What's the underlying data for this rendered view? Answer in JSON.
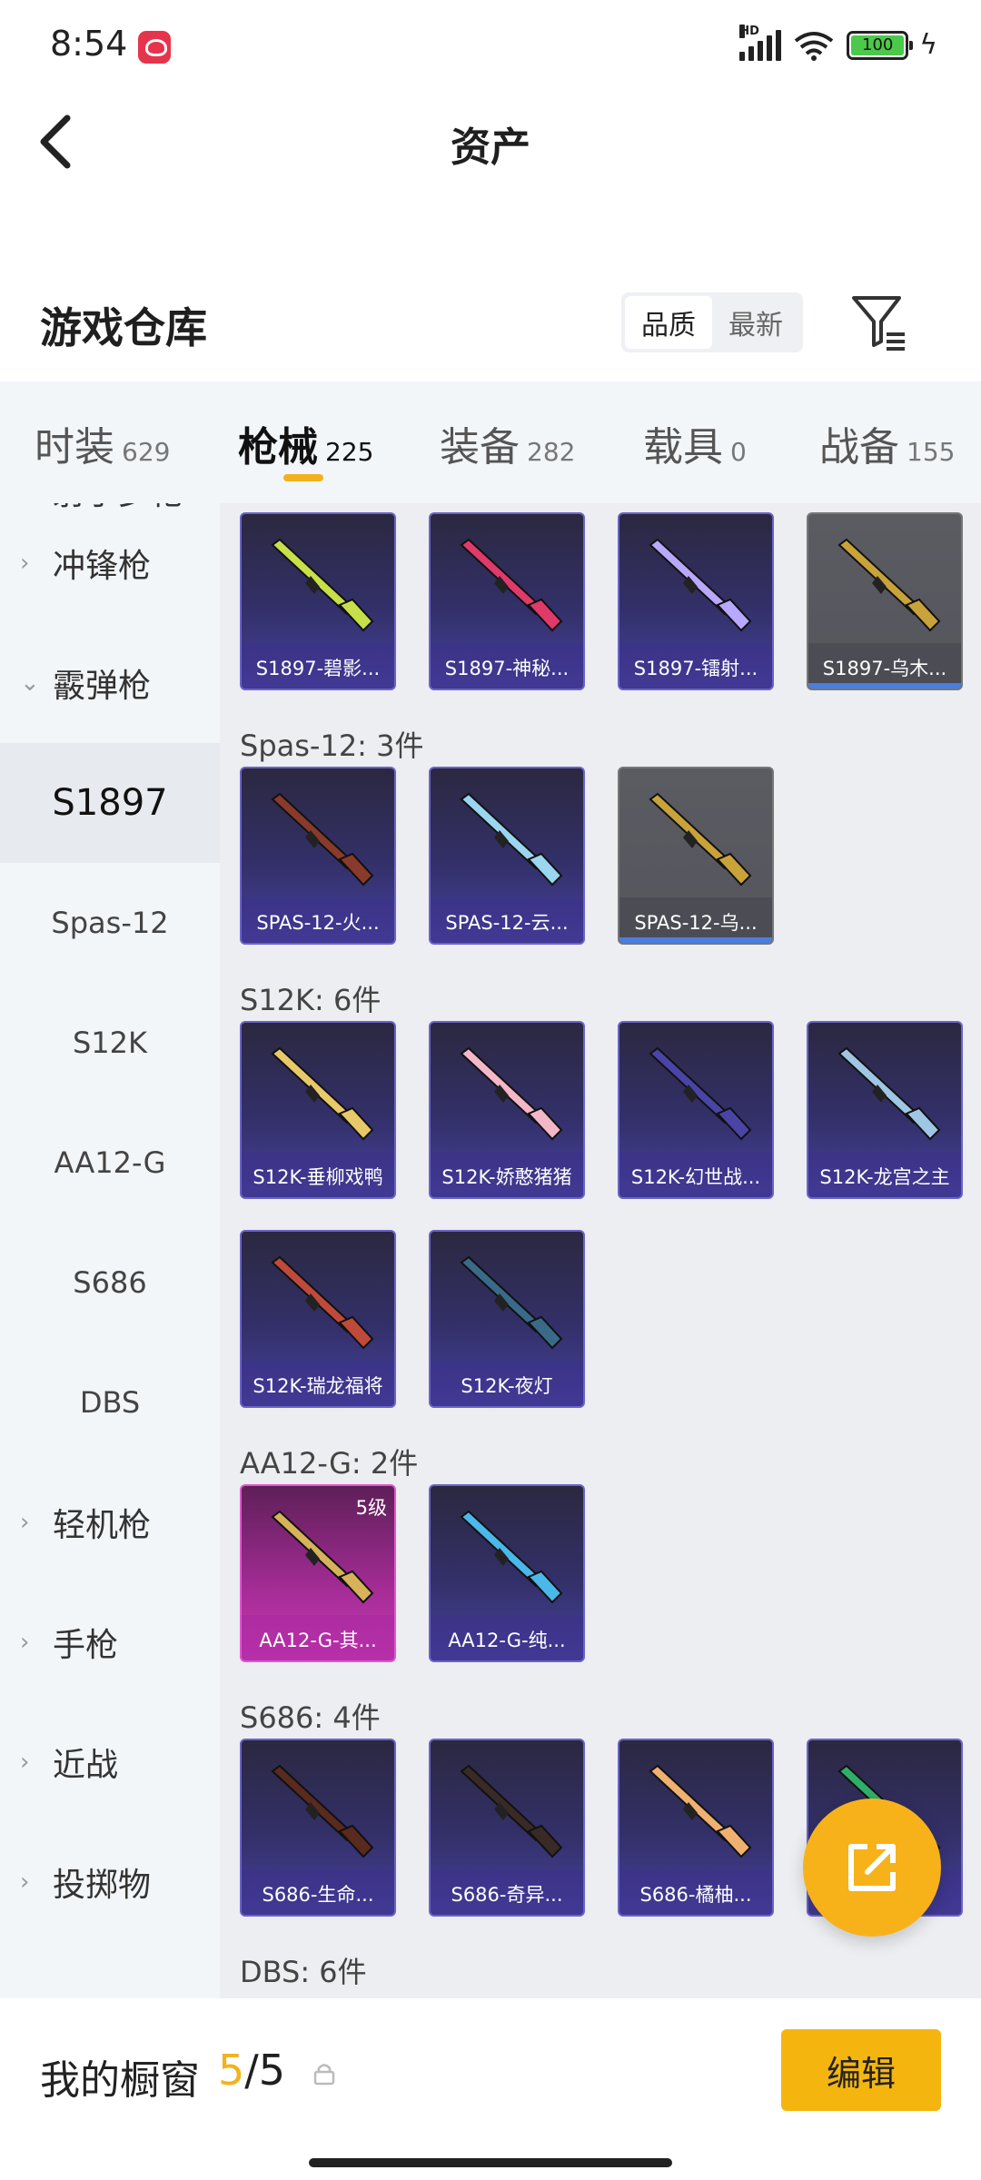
{
  "status_bar": {
    "time": "8:54",
    "battery": "100",
    "signal": "HD"
  },
  "header": {
    "title": "资产"
  },
  "warehouse": {
    "title": "游戏仓库",
    "sort_options": [
      "品质",
      "最新"
    ],
    "sort_selected": "品质"
  },
  "tabs": [
    {
      "label": "时装",
      "count": "629"
    },
    {
      "label": "枪械",
      "count": "225"
    },
    {
      "label": "装备",
      "count": "282"
    },
    {
      "label": "载具",
      "count": "0"
    },
    {
      "label": "战备",
      "count": "155"
    }
  ],
  "sidebar": {
    "partial_top": "射手步枪",
    "items": [
      {
        "type": "category",
        "label": "冲锋枪",
        "expanded": false
      },
      {
        "type": "category",
        "label": "霰弹枪",
        "expanded": true
      },
      {
        "type": "sub",
        "label": "S1897",
        "selected": true
      },
      {
        "type": "sub",
        "label": "Spas-12"
      },
      {
        "type": "sub",
        "label": "S12K"
      },
      {
        "type": "sub",
        "label": "AA12-G"
      },
      {
        "type": "sub",
        "label": "S686"
      },
      {
        "type": "sub",
        "label": "DBS"
      },
      {
        "type": "category",
        "label": "轻机枪",
        "expanded": false
      },
      {
        "type": "category",
        "label": "手枪",
        "expanded": false
      },
      {
        "type": "category",
        "label": "近战",
        "expanded": false
      },
      {
        "type": "category",
        "label": "投掷物",
        "expanded": false
      }
    ]
  },
  "sections": [
    {
      "label": "",
      "items": [
        {
          "name": "S1897-碧影...",
          "style": "purple",
          "gun_color": "#c7e04a"
        },
        {
          "name": "S1897-神秘...",
          "style": "purple",
          "gun_color": "#e03a6a"
        },
        {
          "name": "S1897-镭射...",
          "style": "purple",
          "gun_color": "#b8a8ff"
        },
        {
          "name": "S1897-乌木...",
          "style": "gray",
          "gun_color": "#c9a33a"
        }
      ]
    },
    {
      "label": "Spas-12: 3件",
      "items": [
        {
          "name": "SPAS-12-火...",
          "style": "purple",
          "gun_color": "#8a3a2a"
        },
        {
          "name": "SPAS-12-云...",
          "style": "purple",
          "gun_color": "#9ad6f0"
        },
        {
          "name": "SPAS-12-乌...",
          "style": "gray",
          "gun_color": "#c9a33a"
        }
      ]
    },
    {
      "label": "S12K: 6件",
      "items": [
        {
          "name": "S12K-垂柳戏鸭",
          "style": "purple",
          "gun_color": "#e8c96a"
        },
        {
          "name": "S12K-娇憨猪猪",
          "style": "purple",
          "gun_color": "#f4b7c8"
        },
        {
          "name": "S12K-幻世战...",
          "style": "purple",
          "gun_color": "#4a44a8"
        },
        {
          "name": "S12K-龙宫之主",
          "style": "purple",
          "gun_color": "#9fc6e4"
        },
        {
          "name": "S12K-瑞龙福将",
          "style": "purple",
          "gun_color": "#c04a3a"
        },
        {
          "name": "S12K-夜灯",
          "style": "purple",
          "gun_color": "#3a6a8a"
        }
      ]
    },
    {
      "label": "AA12-G: 2件",
      "items": [
        {
          "name": "AA12-G-其...",
          "style": "pink",
          "gun_color": "#d6b25a",
          "level": "5级"
        },
        {
          "name": "AA12-G-纯...",
          "style": "purple",
          "gun_color": "#4ab8e8"
        }
      ]
    },
    {
      "label": "S686: 4件",
      "items": [
        {
          "name": "S686-生命...",
          "style": "purple",
          "gun_color": "#5a2a1e"
        },
        {
          "name": "S686-奇异...",
          "style": "purple",
          "gun_color": "#3a2a26"
        },
        {
          "name": "S686-橘柚...",
          "style": "purple",
          "gun_color": "#f0b070"
        },
        {
          "name": "",
          "style": "purple",
          "gun_color": "#2fae6a"
        }
      ]
    },
    {
      "label": "DBS: 6件",
      "items": []
    }
  ],
  "bottom": {
    "showcase_label": "我的橱窗",
    "showcase_current": "5",
    "showcase_total": "/5",
    "edit_label": "编辑"
  }
}
